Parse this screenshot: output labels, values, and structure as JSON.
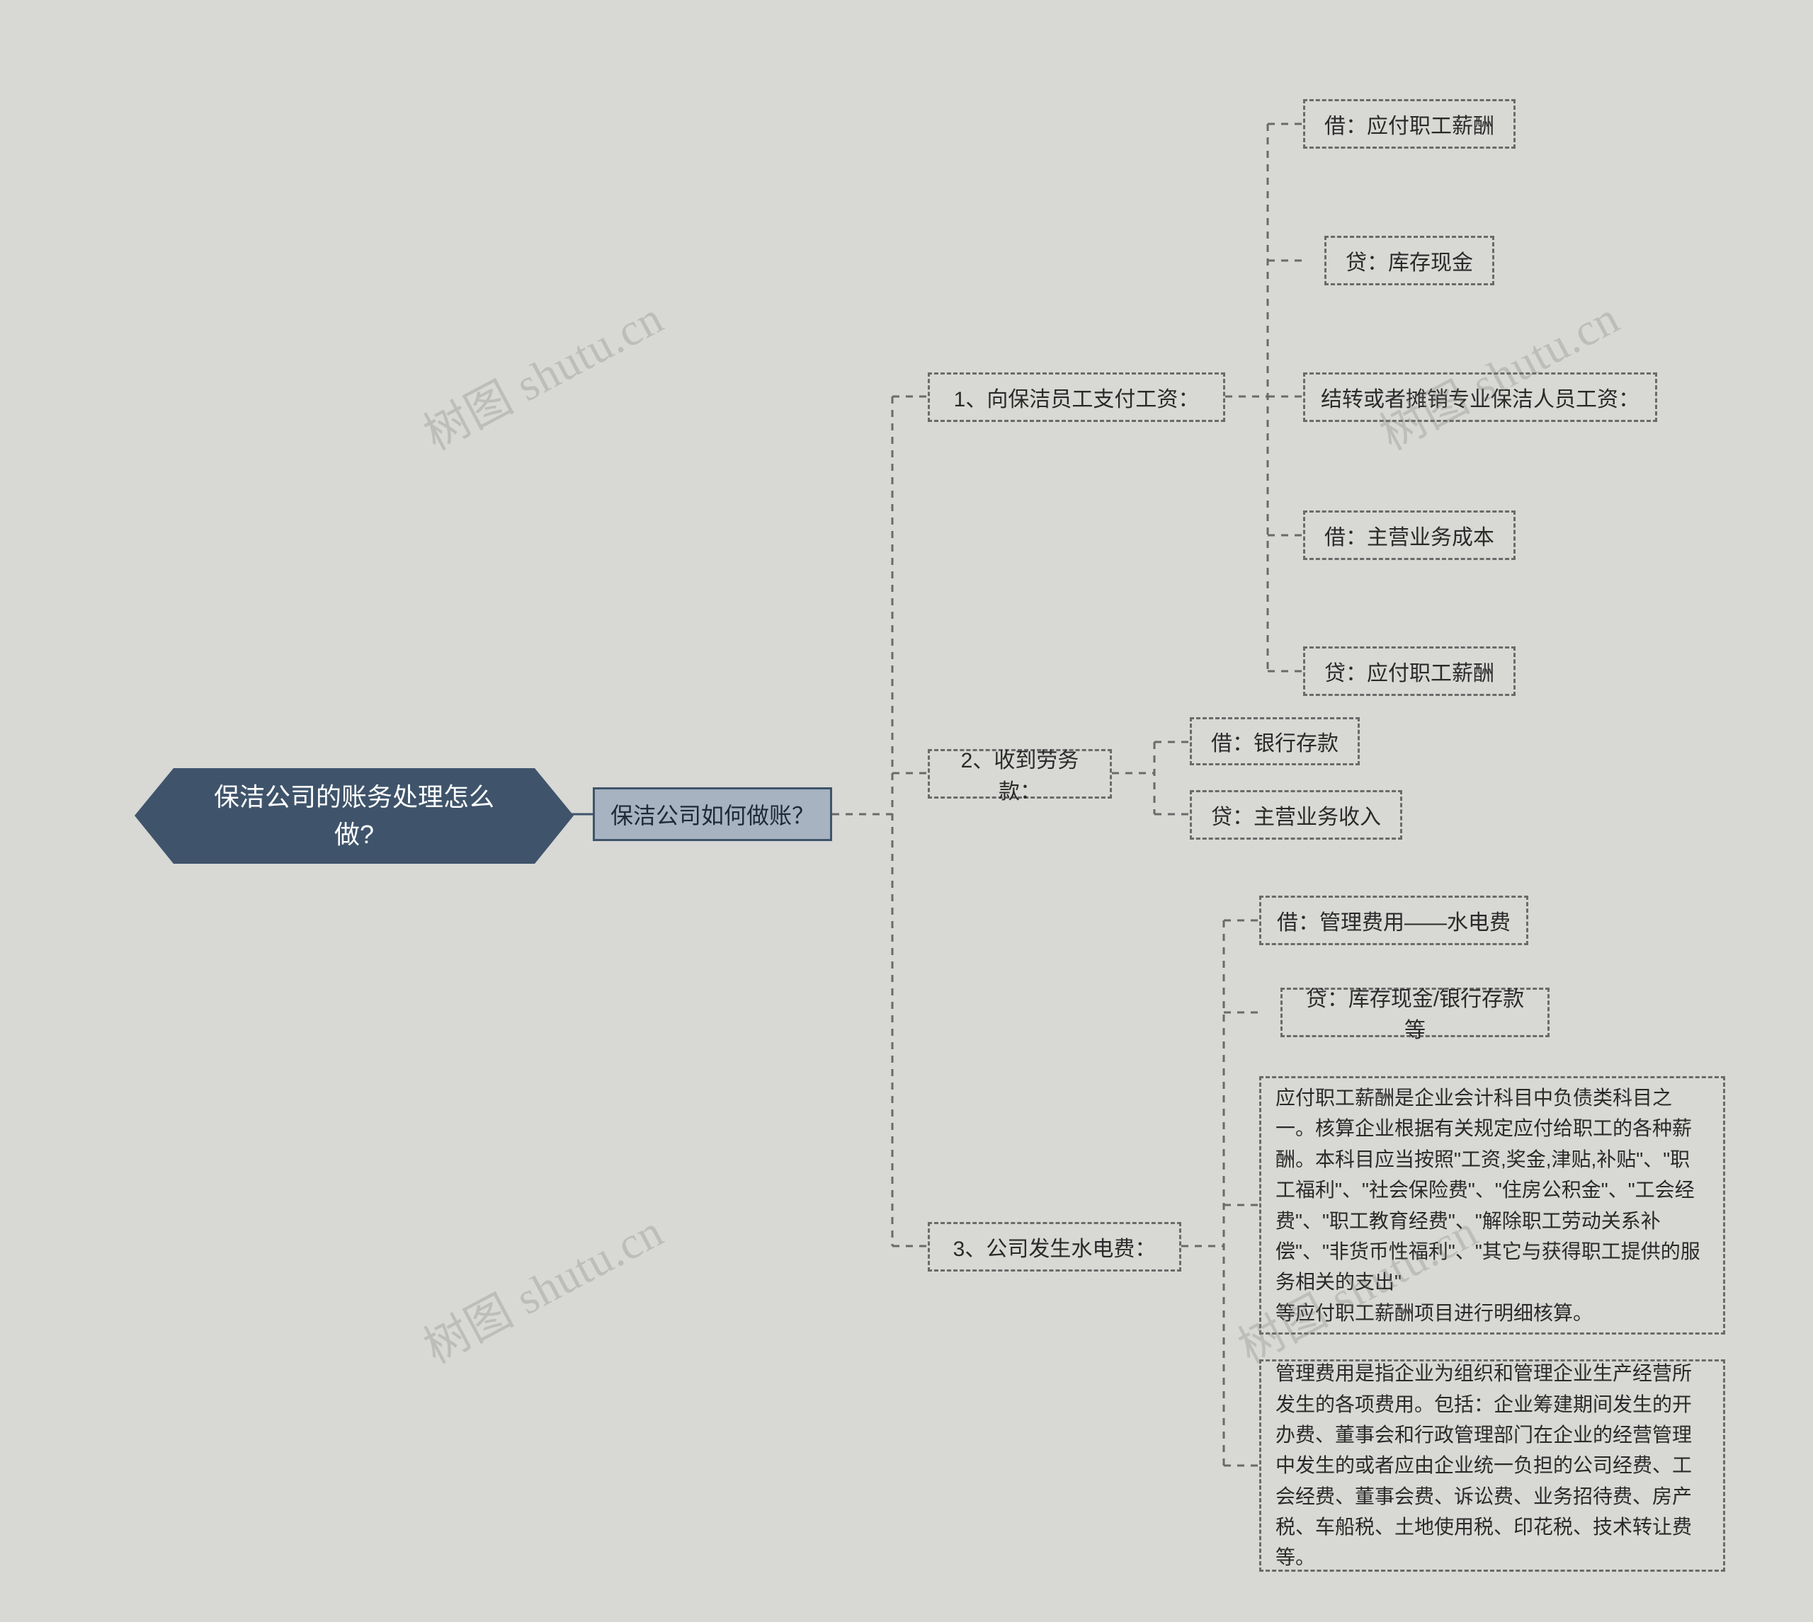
{
  "root": {
    "title": "保洁公司的账务处理怎么\n做?"
  },
  "level1": {
    "label": "保洁公司如何做账？"
  },
  "branches": {
    "b1": {
      "label": "1、向保洁员工支付工资：",
      "children": [
        "借：应付职工薪酬",
        "贷：库存现金",
        "结转或者摊销专业保洁人员工资：",
        "借：主营业务成本",
        "贷：应付职工薪酬"
      ]
    },
    "b2": {
      "label": "2、收到劳务款：",
      "children": [
        "借：银行存款",
        "贷：主营业务收入"
      ]
    },
    "b3": {
      "label": "3、公司发生水电费：",
      "children": [
        "借：管理费用——水电费",
        "贷：库存现金/银行存款等",
        "应付职工薪酬是企业会计科目中负债类科目之一。核算企业根据有关规定应付给职工的各种薪酬。本科目应当按照\"工资,奖金,津贴,补贴\"、\"职工福利\"、\"社会保险费\"、\"住房公积金\"、\"工会经费\"、\"职工教育经费\"、\"解除职工劳动关系补偿\"、\"非货币性福利\"、\"其它与获得职工提供的服务相关的支出\"\n等应付职工薪酬项目进行明细核算。",
        "管理费用是指企业为组织和管理企业生产经营所发生的各项费用。包括：企业筹建期间发生的开办费、董事会和行政管理部门在企业的经营管理中发生的或者应由企业统一负担的公司经费、工会经费、董事会费、诉讼费、业务招待费、房产税、车船税、土地使用税、印花税、技术转让费等。"
      ]
    }
  },
  "watermark": "树图 shutu.cn"
}
